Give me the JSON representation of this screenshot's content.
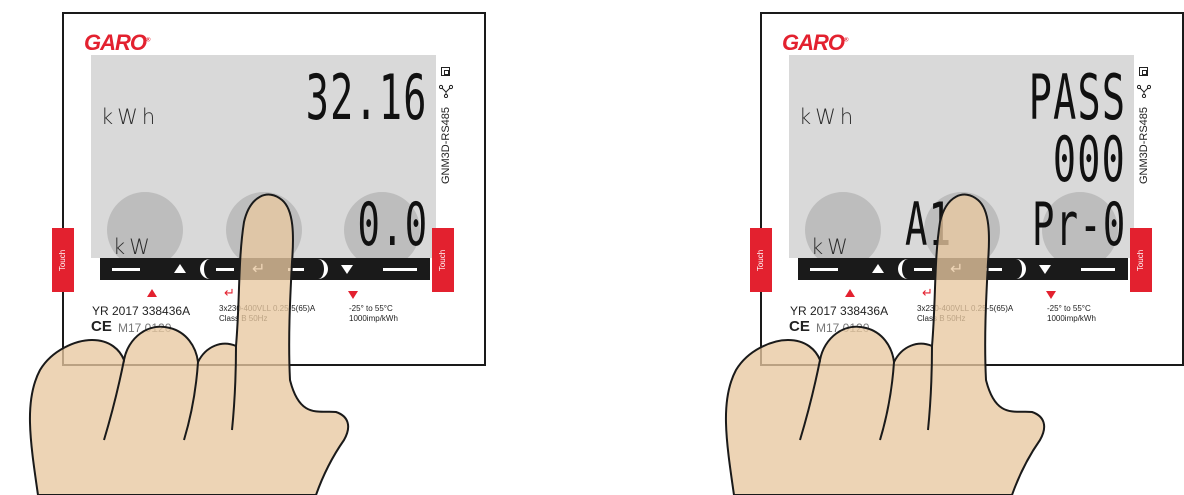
{
  "brand": {
    "logo_text": "GARO",
    "accent": "#e3212f"
  },
  "meters": [
    {
      "id": "left",
      "lcd": {
        "unit_top": "kWh",
        "unit_bottom": "kW",
        "value_top": "32.16",
        "value_bottom": "0.0"
      },
      "model": "GNM3D-RS485",
      "touch_label": "Touch",
      "labels": {
        "yr": "YR 2017 338436A",
        "ce": "CE",
        "mid": "M17 0120",
        "rating_1": "3x230-400VLL 0.25-5(65)A",
        "rating_2": "Class B 50Hz",
        "temp": "-25° to 55°C",
        "imp": "1000imp/kWh"
      }
    },
    {
      "id": "right",
      "lcd": {
        "unit_top": "kWh",
        "unit_bottom": "kW",
        "line1": "PASS",
        "line2": "000",
        "left_code": "A1",
        "right_code": "Pr-0"
      },
      "model": "GNM3D-RS485",
      "touch_label": "Touch",
      "labels": {
        "yr": "YR 2017 338436A",
        "ce": "CE",
        "mid": "M17 0120",
        "rating_1": "3x230-400VLL 0.25-5(65)A",
        "rating_2": "Class B 50Hz",
        "temp": "-25° to 55°C",
        "imp": "1000imp/kWh"
      }
    }
  ],
  "icons": [
    "square-icon",
    "network-icon",
    "up-arrow-icon",
    "enter-icon",
    "down-arrow-icon",
    "hand-pointer-icon"
  ]
}
